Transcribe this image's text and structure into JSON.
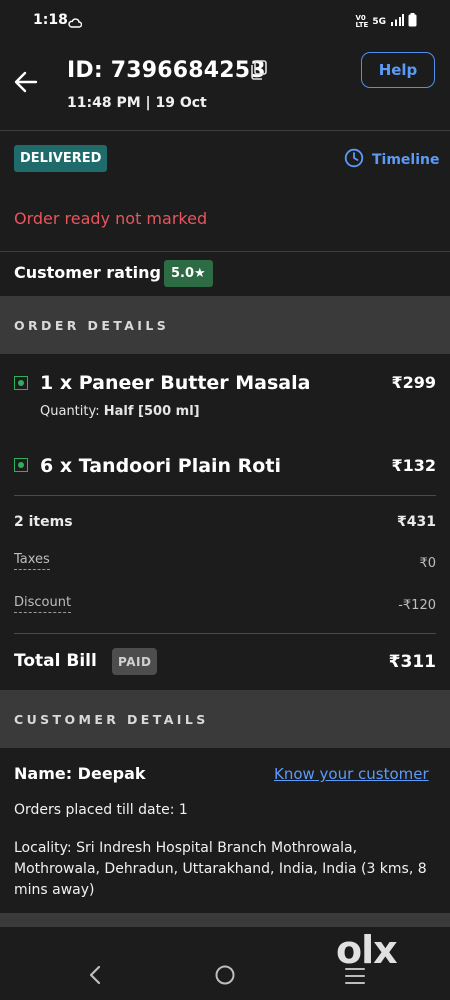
{
  "status_bar": {
    "time": "1:18",
    "network": "5G"
  },
  "header": {
    "order_id": "ID: 7396684253",
    "datetime": "11:48 PM | 19 Oct",
    "help_label": "Help"
  },
  "status": {
    "badge": "DELIVERED",
    "timeline_label": "Timeline",
    "warning": "Order ready not marked"
  },
  "rating": {
    "label": "Customer rating",
    "value": "5.0★"
  },
  "order_details": {
    "heading": "ORDER DETAILS",
    "items": [
      {
        "name": "1 x Paneer Butter Masala",
        "price": "₹299",
        "quantity_label": "Quantity:",
        "quantity_value": "Half [500 ml]"
      },
      {
        "name": "6 x Tandoori Plain Roti",
        "price": "₹132"
      }
    ],
    "summary": {
      "items_label": "2 items",
      "items_value": "₹431",
      "taxes_label": "Taxes",
      "taxes_value": "₹0",
      "discount_label": "Discount",
      "discount_value": "-₹120"
    },
    "total": {
      "label": "Total Bill",
      "badge": "PAID",
      "value": "₹311"
    }
  },
  "customer_details": {
    "heading": "CUSTOMER DETAILS",
    "name": "Name: Deepak",
    "know_link": "Know your customer",
    "orders_placed": "Orders placed till date: 1",
    "locality": "Locality: Sri Indresh Hospital Branch Mothrowala, Mothrowala, Dehradun, Uttarakhand, India, India (3 kms, 8 mins away)"
  },
  "watermark": "olx",
  "colors": {
    "accent_blue": "#5b9bf7",
    "delivered_bg": "#1f6b6b",
    "rating_bg": "#2d6b44",
    "warning_red": "#e8555e",
    "veg_green": "#2fae5e"
  }
}
